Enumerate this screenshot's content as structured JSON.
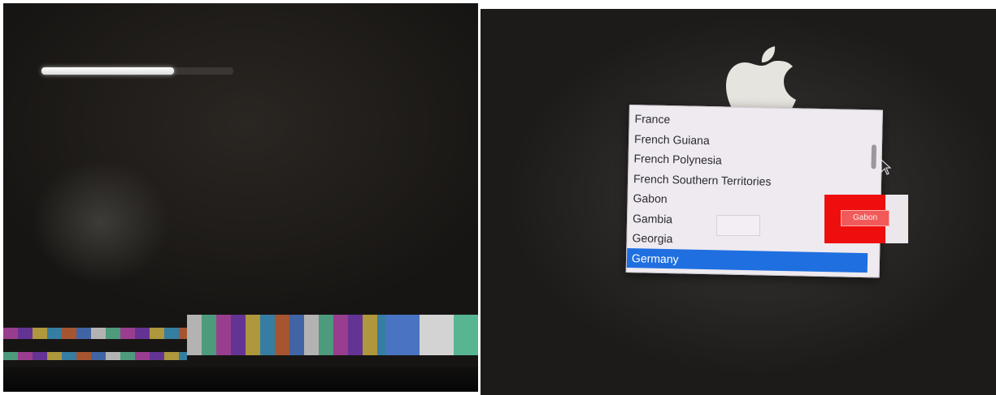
{
  "boot_screen": {
    "progress_fraction": 0.69,
    "progress_color": "#ffffff",
    "track_color": "#3a3633"
  },
  "glitch_colors": [
    "#c44ab8",
    "#4f7fd6",
    "#e0c24a",
    "#5fc7a0",
    "#d46a3a",
    "#7e3fbf",
    "#e8e8e8",
    "#3fa0d0"
  ],
  "setup_screen": {
    "logo_icon": "apple-logo-icon",
    "countries": [
      "France",
      "French Guiana",
      "French Polynesia",
      "French Southern Territories",
      "Gabon",
      "Gambia",
      "Georgia",
      "Germany"
    ],
    "selected_country": "Germany",
    "overlay_button_label": "Gabon",
    "selection_color": "#1f6fe0",
    "overlay_color": "#ef0e0e"
  }
}
